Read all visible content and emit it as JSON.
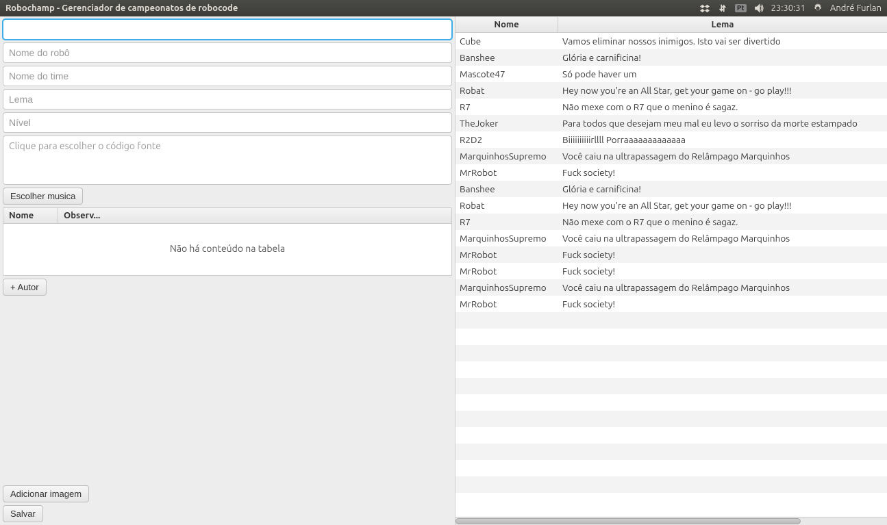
{
  "titlebar": {
    "title": "Robochamp - Gerenciador de campeonatos de robocode",
    "keyboard_layout": "Pt",
    "time": "23:30:31",
    "username": "André Furlan"
  },
  "form": {
    "field0_placeholder": "",
    "robot_name_placeholder": "Nome do robô",
    "team_name_placeholder": "Nome do time",
    "lema_placeholder": "Lema",
    "nivel_placeholder": "Nível",
    "source_placeholder": "Clique para escolher o código fonte",
    "choose_music_label": "Escolher musica",
    "add_author_label": "+ Autor",
    "add_image_label": "Adicionar imagem",
    "save_label": "Salvar"
  },
  "mini_table": {
    "col_nome": "Nome",
    "col_obs": "Observ...",
    "empty_text": "Não há conteúdo na tabela"
  },
  "right_table": {
    "col_nome": "Nome",
    "col_lema": "Lema",
    "rows": [
      {
        "nome": "Cube",
        "lema": "Vamos eliminar nossos inimigos. Isto vai ser divertido"
      },
      {
        "nome": "Banshee",
        "lema": "Glória e carnificina!"
      },
      {
        "nome": "Mascote47",
        "lema": "Só pode haver um"
      },
      {
        "nome": "Robat",
        "lema": "Hey now you're an All Star, get your game on - go play!!!"
      },
      {
        "nome": "R7",
        "lema": "Não mexe com o R7 que o menino é sagaz."
      },
      {
        "nome": "TheJoker",
        "lema": "Para todos que desejam meu mal eu levo o sorriso da morte estampado"
      },
      {
        "nome": "R2D2",
        "lema": "Biiiiiiiiiirllll Porraaaaaaaaaaaaa"
      },
      {
        "nome": "MarquinhosSupremo",
        "lema": "Você caiu na ultrapassagem do Relâmpago Marquinhos"
      },
      {
        "nome": "MrRobot",
        "lema": "Fuck society!"
      },
      {
        "nome": "Banshee",
        "lema": "Glória e carnificina!"
      },
      {
        "nome": "Robat",
        "lema": "Hey now you're an All Star, get your game on - go play!!!"
      },
      {
        "nome": "R7",
        "lema": "Não mexe com o R7 que o menino é sagaz."
      },
      {
        "nome": "MarquinhosSupremo",
        "lema": "Você caiu na ultrapassagem do Relâmpago Marquinhos"
      },
      {
        "nome": "MrRobot",
        "lema": "Fuck society!"
      },
      {
        "nome": "MrRobot",
        "lema": "Fuck society!"
      },
      {
        "nome": "MarquinhosSupremo",
        "lema": "Você caiu na ultrapassagem do Relâmpago Marquinhos"
      },
      {
        "nome": "MrRobot",
        "lema": "Fuck society!"
      }
    ],
    "empty_extra_rows": 12
  }
}
